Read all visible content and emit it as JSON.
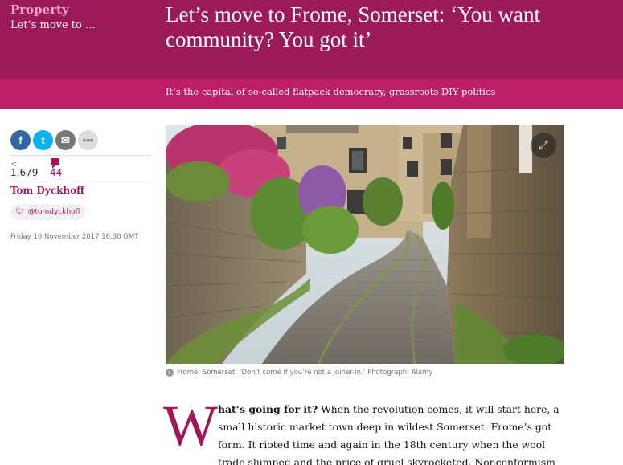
{
  "header": {
    "section": "Property",
    "series": "Let’s move to …",
    "headline": "Let’s move to Frome, Somerset: ‘You want community? You got it’",
    "standfirst": "It’s the capital of so-called flatpack democracy, grassroots DIY politics"
  },
  "meta": {
    "share_count": "1,679",
    "comment_count": "44",
    "author": "Tom Dyckhoff",
    "twitter_handle": "@tomdyckhoff",
    "date": "Friday 10 November 2017 16.30 GMT",
    "share_buttons": [
      {
        "name": "facebook",
        "glyph": "f"
      },
      {
        "name": "twitter",
        "glyph": "t"
      },
      {
        "name": "email",
        "glyph": "✉"
      },
      {
        "name": "more",
        "glyph": "•••"
      }
    ]
  },
  "image": {
    "caption": "Frome, Somerset: ‘Don’t come if you’re not a joiner-in.’ Photograph: Alamy"
  },
  "article": {
    "dropcap": "W",
    "lead": "hat’s going for it?",
    "text": " When the revolution comes, it will start here, a small historic market town deep in wildest Somerset. Frome’s got form. It rioted time and again in the 18th century when the wool trade slumped and the price of gruel skyrocketed. Nonconformism"
  },
  "colors": {
    "header_bg": "#9b1a59",
    "standfirst_bg": "#bd1e66",
    "accent": "#a1185a",
    "section_label": "#f0a6c8"
  }
}
